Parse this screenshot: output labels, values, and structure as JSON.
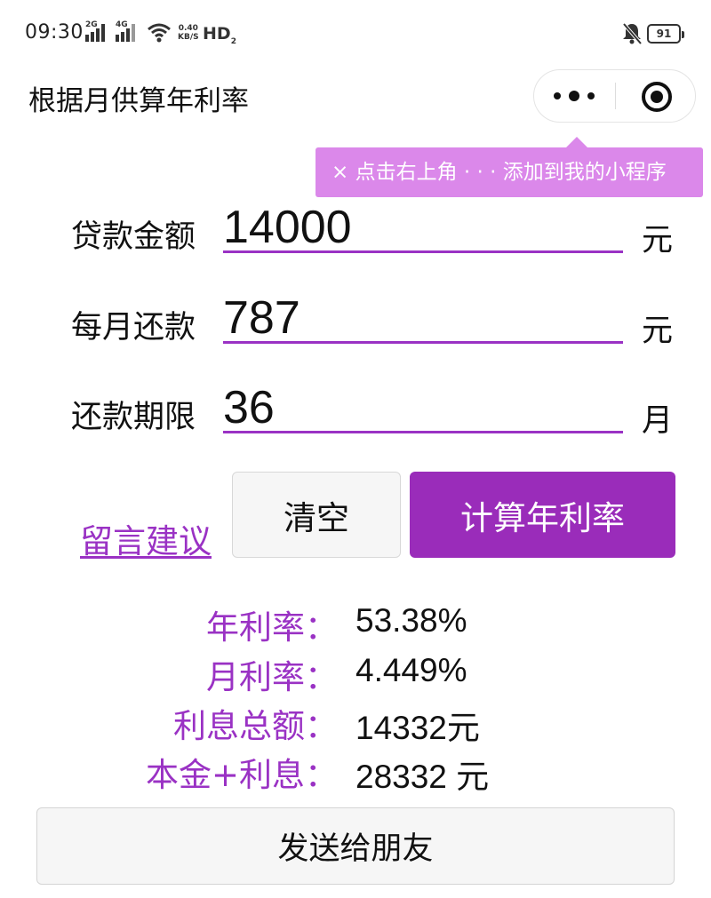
{
  "status": {
    "time": "09:30",
    "sim1": "2G",
    "sim2": "4G",
    "speed_value": "0.40",
    "speed_unit": "KB/S",
    "hd": "HD",
    "hd_sub": "2",
    "battery": "91"
  },
  "nav": {
    "title": "根据月供算年利率"
  },
  "tip": {
    "text": "× 点击右上角 · · · 添加到我的小程序"
  },
  "form": {
    "loan_label": "贷款金额",
    "loan_value": "14000",
    "loan_unit": "元",
    "monthly_label": "每月还款",
    "monthly_value": "787",
    "monthly_unit": "元",
    "term_label": "还款期限",
    "term_value": "36",
    "term_unit": "月"
  },
  "actions": {
    "feedback": "留言建议",
    "clear": "清空",
    "calculate": "计算年利率",
    "share": "发送给朋友"
  },
  "results": {
    "annual_label": "年利率：",
    "annual_value": "53.38%",
    "monthly_label": "月利率：",
    "monthly_value": "4.449%",
    "interest_label": "利息总额：",
    "interest_value": "14332元",
    "total_label": "本金+利息：",
    "total_value": "28332 元"
  },
  "colors": {
    "accent": "#9a2cba",
    "tip_bg": "#db88ea"
  }
}
